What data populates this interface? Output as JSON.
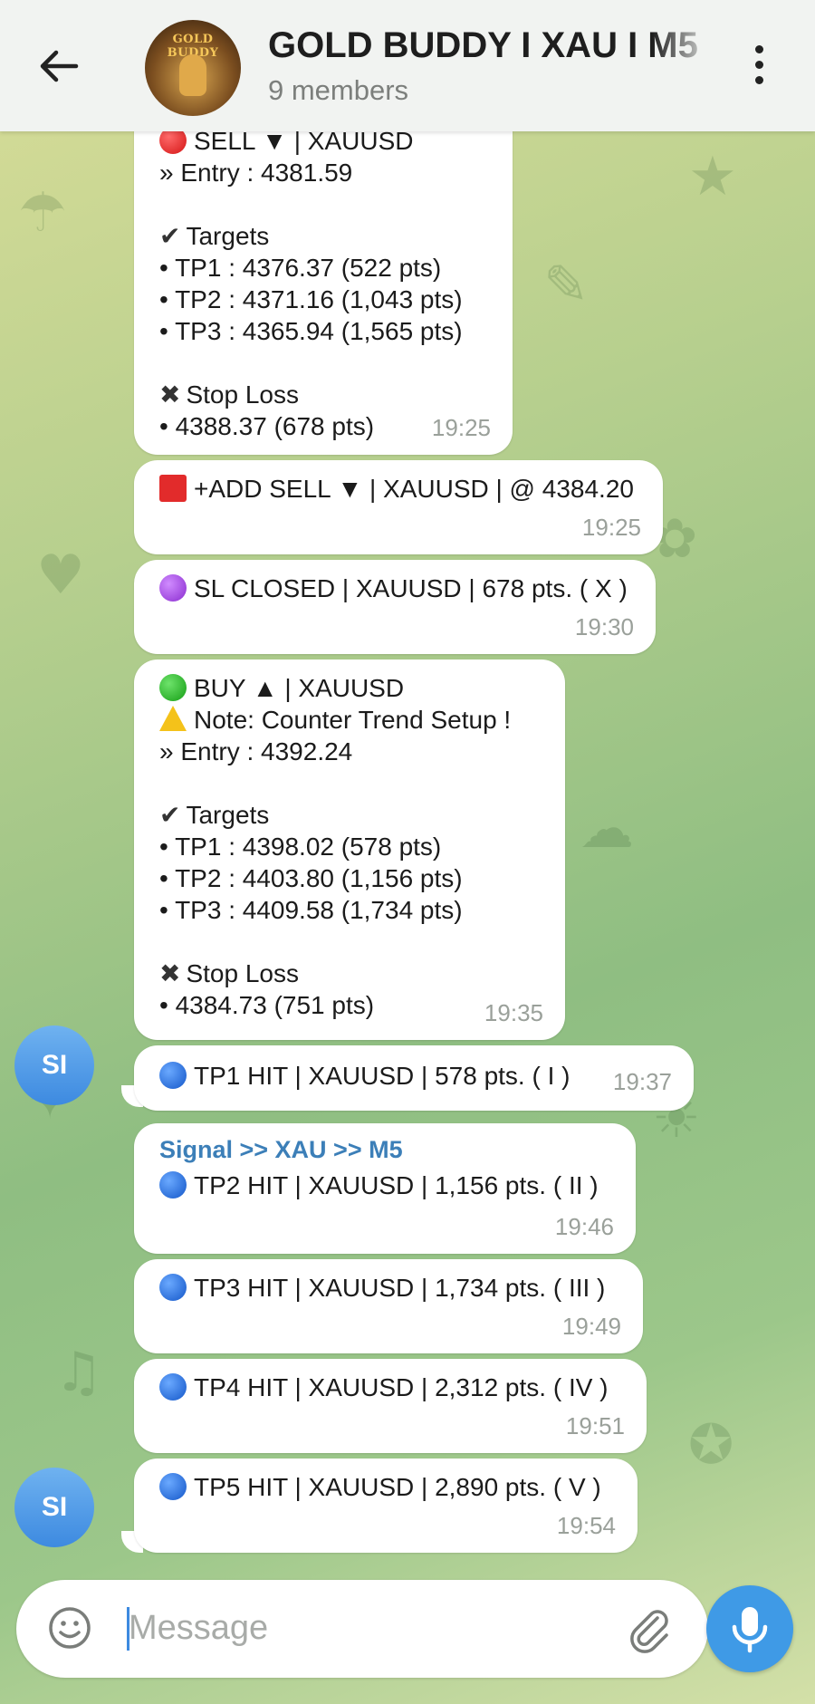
{
  "header": {
    "title": "GOLD BUDDY I XAU I M5",
    "subtitle": "9 members",
    "avatar_text": "GOLD BUDDY",
    "back_icon": "arrow-left-icon",
    "menu_icon": "more-vertical-icon"
  },
  "messages": [
    {
      "lines": [
        "SELL ▼ | XAUUSD",
        "» Entry : 4381.59",
        "",
        "Targets",
        "• TP1 : 4376.37 (522 pts)",
        "• TP2 : 4371.16 (1,043 pts)",
        "• TP3 : 4365.94 (1,565 pts)",
        "",
        "Stop Loss",
        "• 4388.37 (678 pts)"
      ],
      "time": "19:25"
    },
    {
      "text": "+ADD SELL ▼ | XAUUSD | @ 4384.20",
      "time": "19:25"
    },
    {
      "text": "SL CLOSED | XAUUSD | 678 pts. ( X )",
      "time": "19:30"
    },
    {
      "lines": [
        "BUY ▲ | XAUUSD",
        "Note: Counter Trend Setup !",
        "» Entry : 4392.24",
        "",
        "Targets",
        "• TP1 : 4398.02 (578 pts)",
        "• TP2 : 4403.80 (1,156 pts)",
        "• TP3 : 4409.58 (1,734 pts)",
        "",
        "Stop Loss",
        "• 4384.73 (751 pts)"
      ],
      "time": "19:35"
    },
    {
      "text": "TP1 HIT | XAUUSD | 578 pts. ( I )",
      "time": "19:37"
    },
    {
      "sender": "Signal >> XAU >> M5",
      "text": "TP2 HIT | XAUUSD | 1,156 pts. ( II )",
      "time": "19:46"
    },
    {
      "text": "TP3 HIT | XAUUSD | 1,734 pts. ( III )",
      "time": "19:49"
    },
    {
      "text": "TP4 HIT | XAUUSD | 2,312 pts. ( IV )",
      "time": "19:51"
    },
    {
      "text": "TP5 HIT | XAUUSD | 2,890 pts. ( V )",
      "time": "19:54"
    }
  ],
  "avatar_initials": "SI",
  "composer": {
    "placeholder": "Message",
    "emoji_icon": "smile-icon",
    "attach_icon": "paperclip-icon",
    "mic_icon": "microphone-icon"
  },
  "colors": {
    "header_bg": "#f1f3f1",
    "bubble_bg": "#ffffff",
    "sender_name": "#3c7fb8",
    "mic_button": "#3f9ae6"
  }
}
